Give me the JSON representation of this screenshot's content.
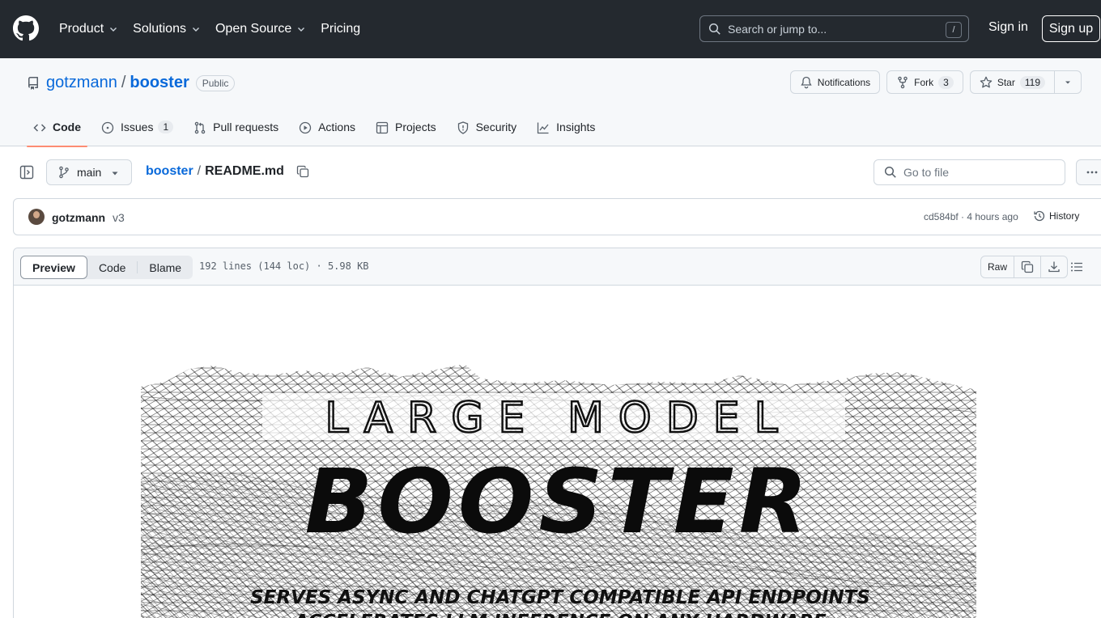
{
  "header": {
    "nav": [
      {
        "label": "Product",
        "has_dropdown": true
      },
      {
        "label": "Solutions",
        "has_dropdown": true
      },
      {
        "label": "Open Source",
        "has_dropdown": true
      },
      {
        "label": "Pricing",
        "has_dropdown": false
      }
    ],
    "search_placeholder": "Search or jump to...",
    "search_shortcut": "/",
    "sign_in": "Sign in",
    "sign_up": "Sign up"
  },
  "repo": {
    "owner": "gotzmann",
    "separator": "/",
    "name": "booster",
    "visibility": "Public",
    "notifications_label": "Notifications",
    "fork_label": "Fork",
    "fork_count": "3",
    "star_label": "Star",
    "star_count": "119"
  },
  "tabs": [
    {
      "label": "Code",
      "icon": "code-icon",
      "active": true
    },
    {
      "label": "Issues",
      "icon": "issue-opened-icon",
      "count": "1"
    },
    {
      "label": "Pull requests",
      "icon": "git-pull-request-icon"
    },
    {
      "label": "Actions",
      "icon": "play-icon"
    },
    {
      "label": "Projects",
      "icon": "table-icon"
    },
    {
      "label": "Security",
      "icon": "shield-icon"
    },
    {
      "label": "Insights",
      "icon": "graph-icon"
    }
  ],
  "file_nav": {
    "branch": "main",
    "breadcrumb_repo": "booster",
    "breadcrumb_sep": "/",
    "breadcrumb_file": "README.md",
    "goto_file_placeholder": "Go to file"
  },
  "commit": {
    "author": "gotzmann",
    "message": "v3",
    "meta": "cd584bf · 4 hours ago",
    "history_label": "History"
  },
  "file_viewer": {
    "views": [
      "Preview",
      "Code",
      "Blame"
    ],
    "active_view": "Preview",
    "info": "192 lines (144 loc) · 5.98 KB",
    "raw_label": "Raw"
  },
  "readme_banner": {
    "line1": "LARGE MODEL",
    "line2": "BOOSTER",
    "line3": "SERVES ASYNC AND CHATGPT COMPATIBLE API ENDPOINTS",
    "line4": "ACCELERATES LLM INFERENCE ON ANY HARDWARE"
  },
  "colors": {
    "header_bg": "#24292f",
    "link": "#0969da",
    "active_tab_underline": "#fd8c73",
    "border": "#d0d7de",
    "muted_text": "#57606a"
  }
}
